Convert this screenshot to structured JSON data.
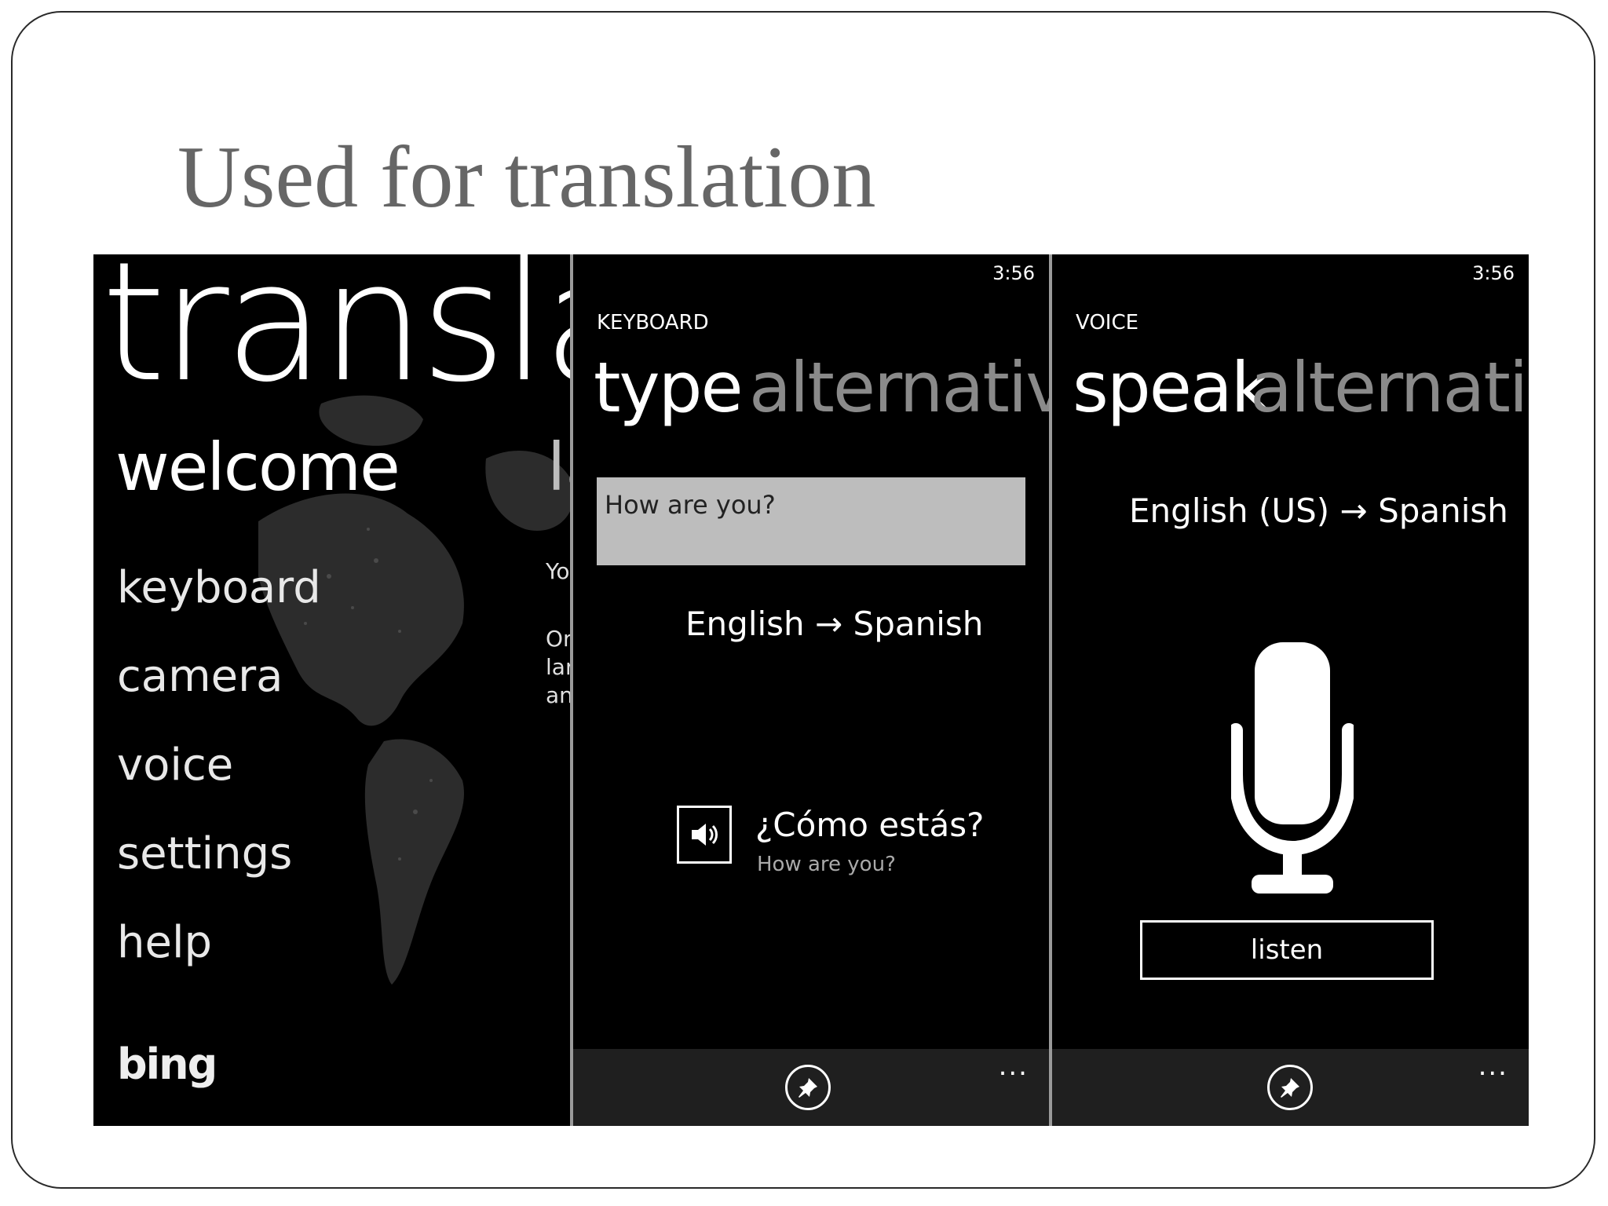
{
  "slide": {
    "title": "Used for translation"
  },
  "welcome_screen": {
    "title": "transla",
    "heading": "welcome",
    "next_heading_peek": "la",
    "menu": [
      "keyboard",
      "camera",
      "voice",
      "settings",
      "help"
    ],
    "side_text_peek": [
      "Yo",
      "Or",
      "lar",
      "an"
    ],
    "brand": "bing"
  },
  "keyboard_screen": {
    "time": "3:56",
    "section": "KEYBOARD",
    "pivot_active": "type",
    "pivot_next": "alternative",
    "input_value": "How are you?",
    "language_pair": "English → Spanish",
    "result_translation": "¿Cómo estás?",
    "result_source": "How are you?",
    "more": "..."
  },
  "voice_screen": {
    "time": "3:56",
    "section": "VOICE",
    "pivot_active": "speak",
    "pivot_next": "alternati",
    "language_pair": "English (US) → Spanish",
    "listen_label": "listen",
    "more": "..."
  }
}
